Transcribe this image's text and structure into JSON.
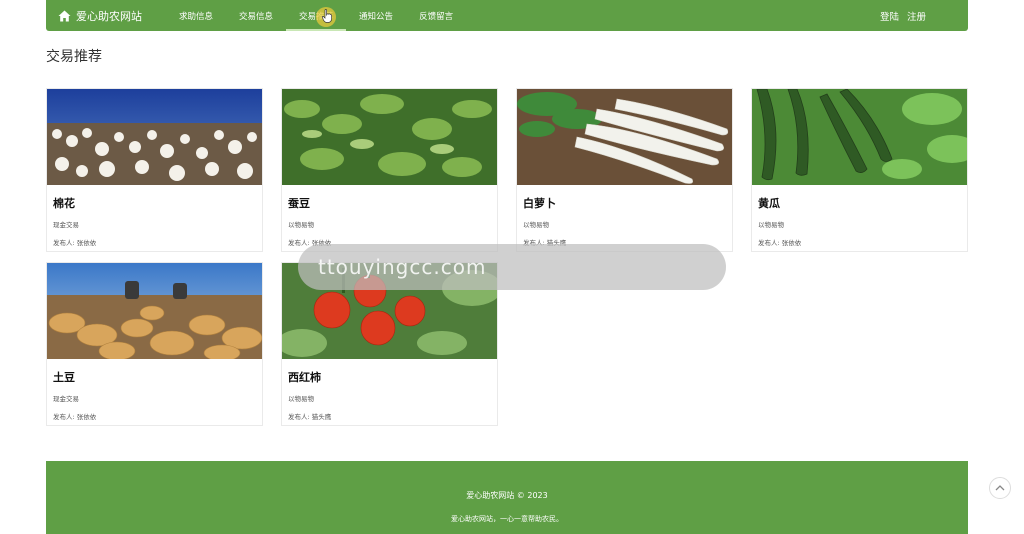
{
  "brand": {
    "name": "爱心助农网站"
  },
  "nav": {
    "items": [
      {
        "label": "求助信息"
      },
      {
        "label": "交易信息"
      },
      {
        "label": "交易推荐"
      },
      {
        "label": "通知公告"
      },
      {
        "label": "反馈留言"
      }
    ],
    "active_index": 2,
    "login": "登陆",
    "register": "注册"
  },
  "section": {
    "title": "交易推荐"
  },
  "cards": [
    {
      "name": "棉花",
      "type": "现金交易",
      "publisher": "发布人: 张依依"
    },
    {
      "name": "蚕豆",
      "type": "以物易物",
      "publisher": "发布人: 张依依"
    },
    {
      "name": "白萝卜",
      "type": "以物易物",
      "publisher": "发布人: 猫头鹰"
    },
    {
      "name": "黄瓜",
      "type": "以物易物",
      "publisher": "发布人: 张依依"
    },
    {
      "name": "土豆",
      "type": "现金交易",
      "publisher": "发布人: 张依依"
    },
    {
      "name": "西红柿",
      "type": "以物易物",
      "publisher": "发布人: 猫头鹰"
    }
  ],
  "watermark": {
    "text": "ttouyingcc.com"
  },
  "footer": {
    "copyright": "爱心助农网站 © 2023",
    "slogan": "爱心助农网站，一心一意帮助农民。"
  },
  "colors": {
    "primary": "#5f9f45",
    "accent_underline": "#c9e7b5"
  },
  "icons": {
    "brand": "home-icon",
    "back_top": "chevron-up-icon"
  }
}
